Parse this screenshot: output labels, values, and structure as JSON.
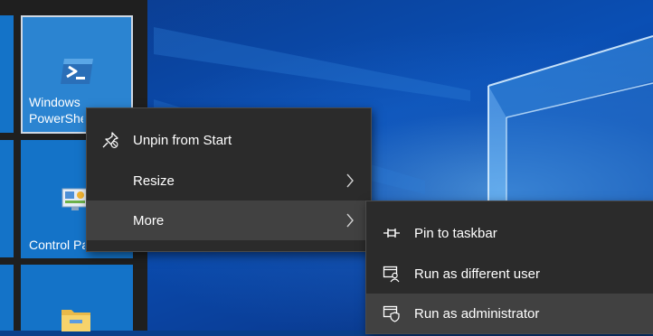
{
  "tiles": {
    "powershell": {
      "label_line1": "Windows",
      "label_line2": "PowerShell",
      "icon": "powershell-icon"
    },
    "control_panel": {
      "label": "Control Panel",
      "icon": "control-panel-icon"
    },
    "file_explorer": {
      "label": "",
      "icon": "folder-icon"
    }
  },
  "context_menu": {
    "items": [
      {
        "label": "Unpin from Start",
        "icon": "unpin-icon"
      },
      {
        "label": "Resize",
        "icon": "",
        "submenu": true
      },
      {
        "label": "More",
        "icon": "",
        "submenu": true,
        "hover": true
      }
    ]
  },
  "submenu": {
    "items": [
      {
        "label": "Pin to taskbar",
        "icon": "pin-icon"
      },
      {
        "label": "Run as different user",
        "icon": "user-window-icon"
      },
      {
        "label": "Run as administrator",
        "icon": "shield-window-icon",
        "hover": true
      }
    ]
  },
  "colors": {
    "tile_blue": "#1473c8",
    "menu_bg": "#2b2b2b",
    "menu_hover": "#414141",
    "start_bg": "#1f1f1f"
  }
}
